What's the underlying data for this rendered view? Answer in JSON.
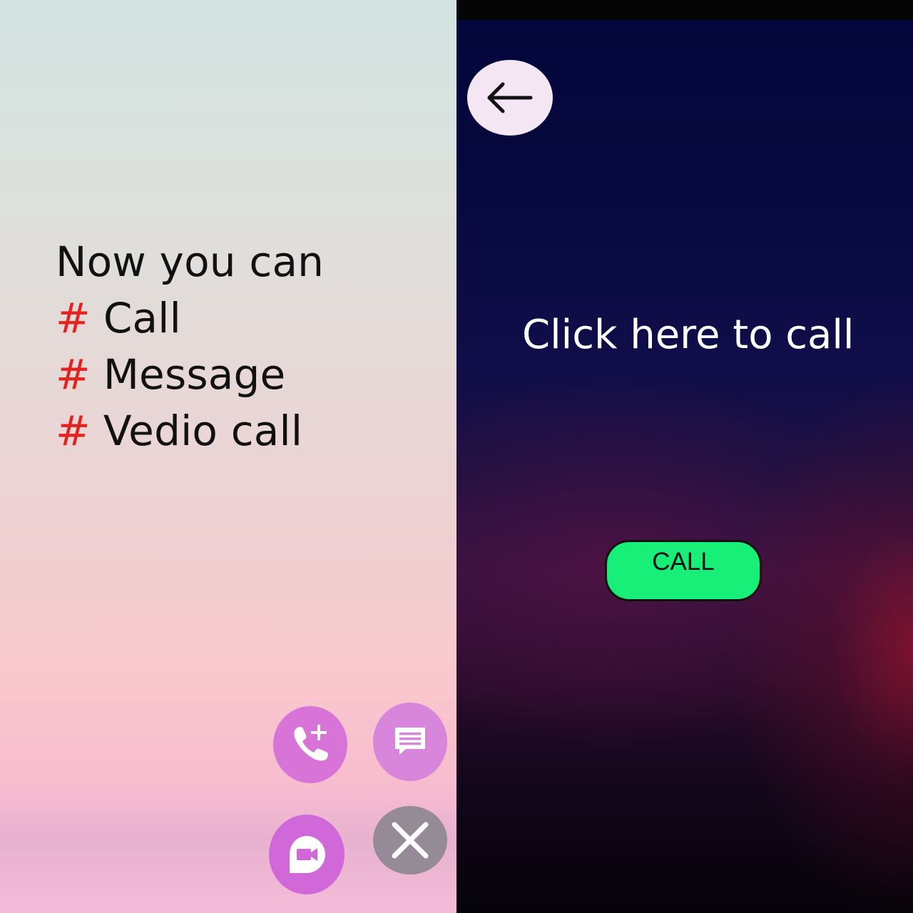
{
  "left_panel": {
    "intro": "Now you can",
    "features": [
      {
        "marker": "#",
        "label": "Call"
      },
      {
        "marker": "#",
        "label": "Message"
      },
      {
        "marker": "#",
        "label": "Vedio call"
      }
    ],
    "fab_icons": {
      "add_call": "add-call-icon",
      "message": "message-icon",
      "video": "video-call-icon",
      "close": "close-icon"
    }
  },
  "right_panel": {
    "back_icon": "arrow-left-icon",
    "prompt": "Click here to call",
    "call_button_label": "CALL",
    "call_button_color": "#17ef78"
  }
}
